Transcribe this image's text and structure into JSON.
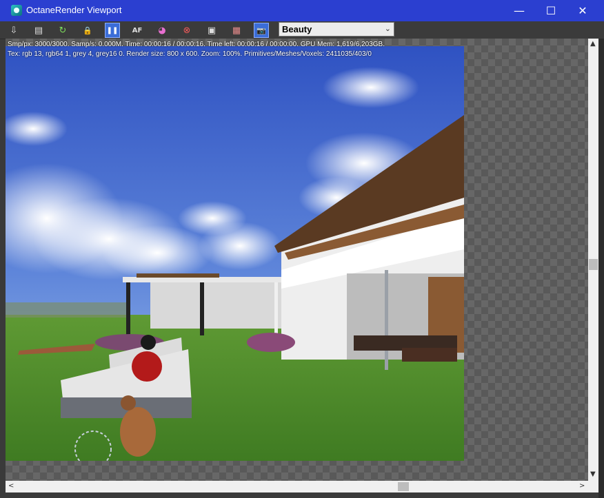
{
  "window": {
    "title": "OctaneRender Viewport",
    "minimize_glyph": "—",
    "maximize_glyph": "☐",
    "close_glyph": "✕"
  },
  "toolbar": {
    "buttons": [
      {
        "icon": "export-icon",
        "glyph": "⇩"
      },
      {
        "icon": "clipboard-icon",
        "glyph": "▤"
      },
      {
        "icon": "restart-icon",
        "glyph": "↻"
      },
      {
        "icon": "lock-icon",
        "glyph": "🔒"
      },
      {
        "icon": "pause-icon",
        "glyph": "❚❚"
      },
      {
        "icon": "autofocus-icon",
        "glyph": "AF"
      },
      {
        "icon": "color-picker-icon",
        "glyph": "◕"
      },
      {
        "icon": "region-render-icon",
        "glyph": "⊗"
      },
      {
        "icon": "display-icon",
        "glyph": "▣"
      },
      {
        "icon": "film-icon",
        "glyph": "▦"
      },
      {
        "icon": "camera-icon",
        "glyph": "📷"
      }
    ],
    "pass_select": {
      "value": "Beauty",
      "chevron": "⌄"
    }
  },
  "stats": {
    "line1": "Smp/px: 3000/3000.   Samp/s: 0.000M.   Time: 00:00:16 / 00:00:16.   Time left: 00:00:16 / 00:00:00.   GPU Mem: 1,619/6,203GB.",
    "line2": "Tex: rgb 13, rgb64 1, grey 4, grey16 0.   Render size: 800 x 600.   Zoom: 100%.   Primitives/Meshes/Voxels: 2411035/403/0"
  },
  "scroll": {
    "up": "▲",
    "down": "▼",
    "left": "<",
    "right": ">"
  },
  "colors": {
    "titlebar": "#2b3fd0",
    "sky_top": "#3e63c9",
    "grass": "#4e8a2c"
  }
}
